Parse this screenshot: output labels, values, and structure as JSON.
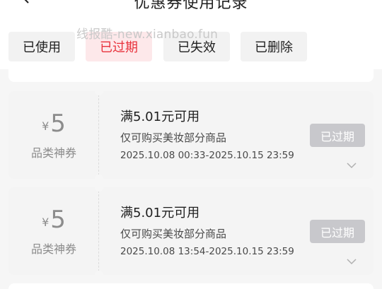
{
  "header": {
    "title": "优惠券使用记录"
  },
  "watermark": "线报酷-new.xianbao.fun",
  "tabs": [
    {
      "label": "已使用",
      "active": false
    },
    {
      "label": "已过期",
      "active": true
    },
    {
      "label": "已失效",
      "active": false
    },
    {
      "label": "已删除",
      "active": false
    }
  ],
  "colors": {
    "accent": "#e8323c",
    "active_tab_bg": "#fde8ea",
    "status_badge_bg": "#c8c8cc",
    "card_bg": "#f4f4f4"
  },
  "coupons": [
    {
      "currency": "¥",
      "amount": "5",
      "type": "品类神券",
      "condition": "满5.01元可用",
      "scope": "仅可购买美妆部分商品",
      "validity": "2025.10.08 00:33-2025.10.15 23:59",
      "status": "已过期"
    },
    {
      "currency": "¥",
      "amount": "5",
      "type": "品类神券",
      "condition": "满5.01元可用",
      "scope": "仅可购买美妆部分商品",
      "validity": "2025.10.08 13:54-2025.10.15 23:59",
      "status": "已过期"
    }
  ],
  "icons": {
    "back": "chevron-left-icon",
    "expand": "chevron-down-icon"
  }
}
